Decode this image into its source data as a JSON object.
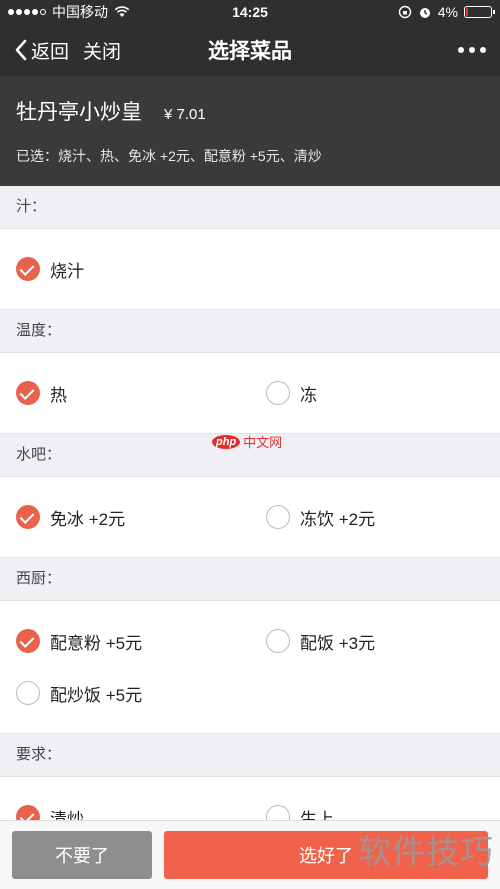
{
  "status_bar": {
    "carrier": "中国移动",
    "time": "14:25",
    "battery": "4%",
    "battery_level": 0.04
  },
  "nav": {
    "back_label": "返回",
    "close_label": "关闭",
    "title": "选择菜品"
  },
  "dish": {
    "name": "牡丹亭小炒皇",
    "price": "¥ 7.01",
    "selected": "已选：烧汁、热、免冰 +2元、配意粉 +5元、清炒"
  },
  "sections": [
    {
      "title": "汁：",
      "options": [
        {
          "label": "烧汁",
          "checked": true
        }
      ]
    },
    {
      "title": "温度：",
      "options": [
        {
          "label": "热",
          "checked": true
        },
        {
          "label": "冻",
          "checked": false
        }
      ]
    },
    {
      "title": "水吧：",
      "options": [
        {
          "label": "免冰 +2元",
          "checked": true
        },
        {
          "label": "冻饮 +2元",
          "checked": false
        }
      ]
    },
    {
      "title": "西厨：",
      "options": [
        {
          "label": "配意粉 +5元",
          "checked": true
        },
        {
          "label": "配饭 +3元",
          "checked": false
        },
        {
          "label": "配炒饭 +5元",
          "checked": false
        }
      ]
    },
    {
      "title": "要求：",
      "options": [
        {
          "label": "清炒",
          "checked": true
        },
        {
          "label": "生上",
          "checked": false
        }
      ]
    }
  ],
  "bottom": {
    "cancel_label": "不要了",
    "ok_label": "选好了"
  },
  "watermarks": {
    "php_logo": "php",
    "php_text": "中文网",
    "corner": "软件技巧"
  },
  "colors": {
    "accent": "#e9624c",
    "header_bg": "#2f2f2f"
  }
}
